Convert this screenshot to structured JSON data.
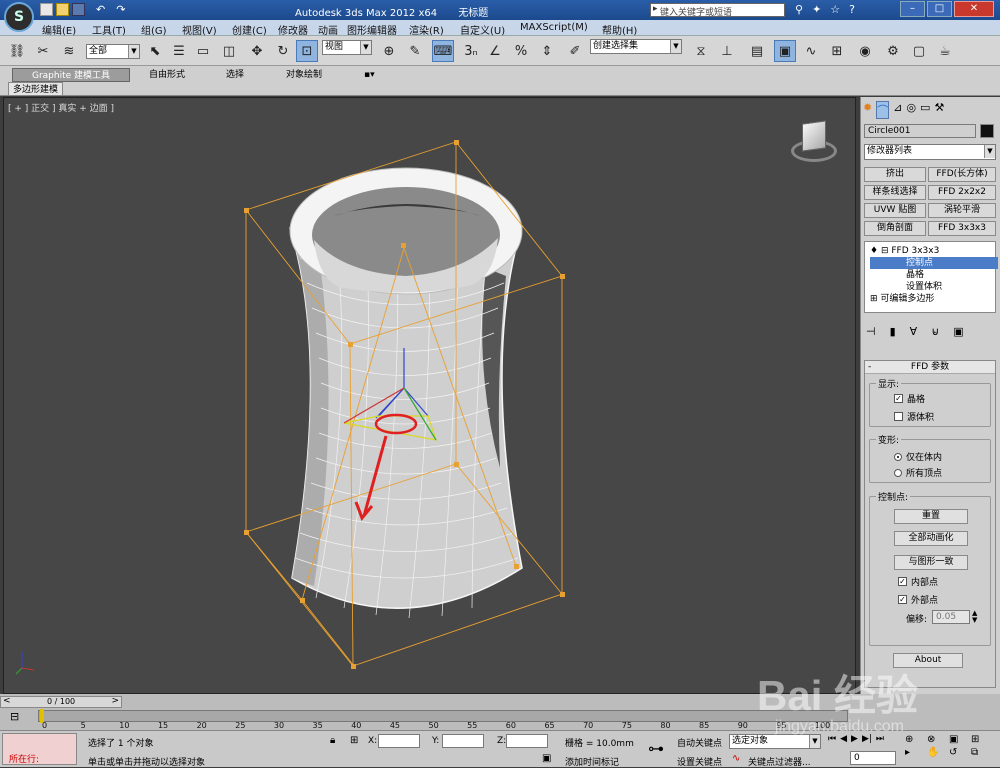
{
  "title": {
    "app": "Autodesk 3ds Max  2012 x64",
    "doc": "无标题",
    "search_placeholder": "键入关键字或短语"
  },
  "menu": [
    "编辑(E)",
    "工具(T)",
    "组(G)",
    "视图(V)",
    "创建(C)",
    "修改器",
    "动画",
    "图形编辑器",
    "渲染(R)",
    "自定义(U)",
    "MAXScript(M)",
    "帮助(H)"
  ],
  "toolbar": {
    "selection_filter": "全部",
    "ref_coord": "视图",
    "named_selection": "创建选择集"
  },
  "ribbon": {
    "tabs": [
      "Graphite 建模工具",
      "自由形式",
      "选择",
      "对象绘制"
    ],
    "sub_label": "多边形建模"
  },
  "viewport": {
    "label": "[ + ] 正交 ] 真实 + 边面 ]"
  },
  "cmd_panel": {
    "object_name": "Circle001",
    "modifier_list": "修改器列表",
    "mod_buttons": [
      "挤出",
      "FFD(长方体)",
      "样条线选择",
      "FFD 2x2x2",
      "UVW 贴图",
      "涡轮平滑",
      "倒角剖面",
      "FFD 3x3x3"
    ],
    "stack": [
      "FFD 3x3x3",
      "控制点",
      "晶格",
      "设置体积",
      "可编辑多边形"
    ],
    "rollout_title": "FFD 参数",
    "display_group": "显示:",
    "lattice": "晶格",
    "source_volume": "源体积",
    "deform_group": "变形:",
    "only_in_volume": "仅在体内",
    "all_vertices": "所有顶点",
    "cp_group": "控制点:",
    "reset_btn": "重置",
    "animate_all_btn": "全部动画化",
    "conform_btn": "与图形一致",
    "inside_pts": "内部点",
    "outside_pts": "外部点",
    "offset_label": "偏移:",
    "offset_value": "0.05",
    "about_btn": "About"
  },
  "timeline": {
    "frame_counter": "0 / 100",
    "ticks": [
      "0",
      "5",
      "10",
      "15",
      "20",
      "25",
      "30",
      "35",
      "40",
      "45",
      "50",
      "55",
      "60",
      "65",
      "70",
      "75",
      "80",
      "85",
      "90",
      "95",
      "100"
    ]
  },
  "status": {
    "selected": "选择了 1 个对象",
    "prompt": "单击或单击并拖动以选择对象",
    "in_progress": "所在行:",
    "x_label": "X:",
    "y_label": "Y:",
    "z_label": "Z:",
    "grid": "栅格 = 10.0mm",
    "add_time_tag": "添加时间标记",
    "auto_key": "自动关键点",
    "set_key": "设置关键点",
    "key_mode_value": "选定对象",
    "key_filters": "关键点过滤器...",
    "current_frame": "0"
  },
  "watermark": {
    "brand": "Bai 经验",
    "url": "jingyan.baidu.com"
  },
  "colors": {
    "title_bar": "#1c4a8e",
    "selection_highlight": "#4a7cc8",
    "lattice": "#e8a030",
    "annotation_red": "#e02020"
  }
}
